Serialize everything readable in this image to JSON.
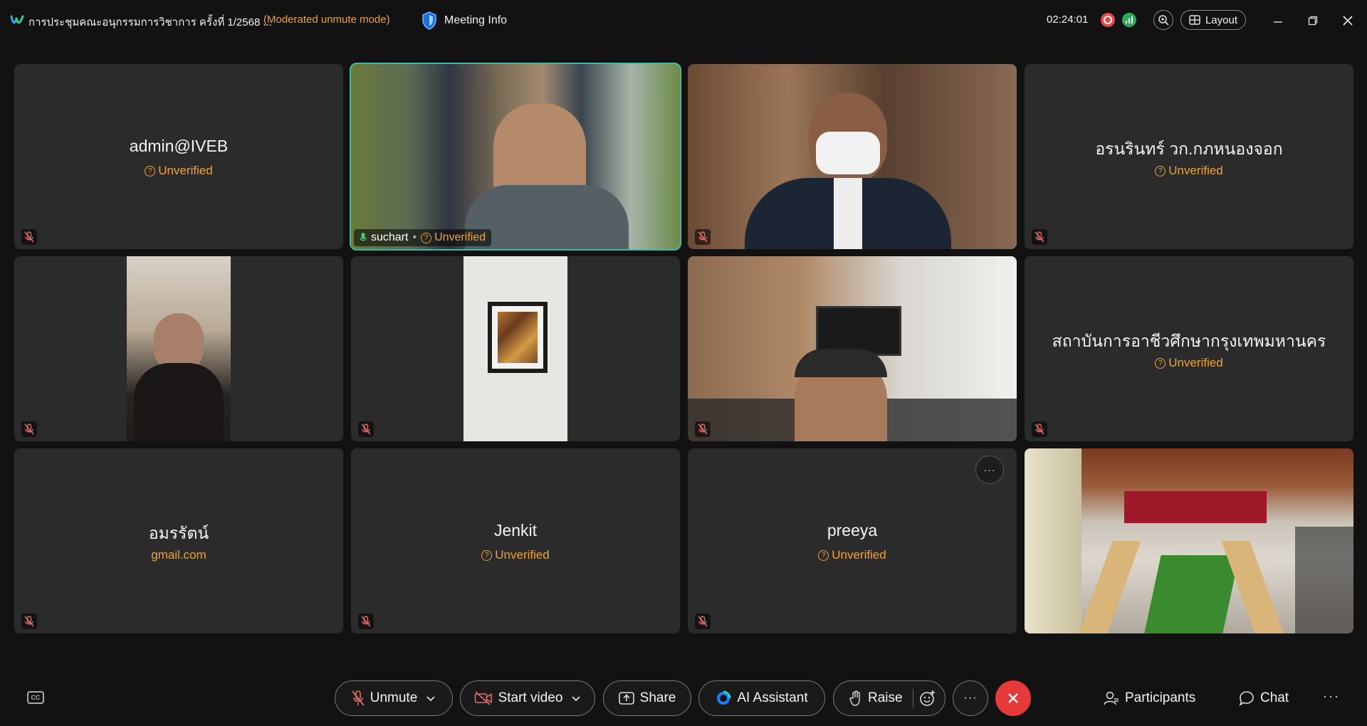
{
  "titlebar": {
    "meeting_title": "การประชุมคณะอนุกรรมการวิชาการ ครั้งที่ 1/2568 ...",
    "mode": "(Moderated unmute mode)",
    "meeting_info_label": "Meeting Info",
    "clock": "02:24:01",
    "layout_label": "Layout"
  },
  "participants": [
    {
      "name": "admin@IVEB",
      "sub": "Unverified",
      "video": false
    },
    {
      "name": "suchart",
      "sub": "Unverified",
      "video": true,
      "active": true
    },
    {
      "name": "",
      "sub": "",
      "video": true
    },
    {
      "name": "อรนรินทร์ วก.กภหนองจอก",
      "sub": "Unverified",
      "video": false
    },
    {
      "name": "",
      "sub": "",
      "video": true
    },
    {
      "name": "",
      "sub": "",
      "video": true
    },
    {
      "name": "",
      "sub": "",
      "video": true
    },
    {
      "name": "สถาบันการอาชีวศึกษากรุงเทพมหานคร",
      "sub": "Unverified",
      "video": false
    },
    {
      "name": "อมรรัตน์",
      "sub": "gmail.com",
      "video": false
    },
    {
      "name": "Jenkit",
      "sub": "Unverified",
      "video": false
    },
    {
      "name": "preeya",
      "sub": "Unverified",
      "video": false
    },
    {
      "name": "",
      "sub": "",
      "video": true
    }
  ],
  "toolbar": {
    "unmute": "Unmute",
    "start_video": "Start video",
    "share": "Share",
    "ai_assistant": "AI Assistant",
    "raise": "Raise",
    "participants": "Participants",
    "chat": "Chat",
    "cc": "CC",
    "more": "···"
  },
  "colors": {
    "accent_orange": "#f0a23a",
    "active_border": "#3fb9a3",
    "end_call": "#e63a3a",
    "recording": "#e5484d",
    "signal": "#2faa55"
  }
}
